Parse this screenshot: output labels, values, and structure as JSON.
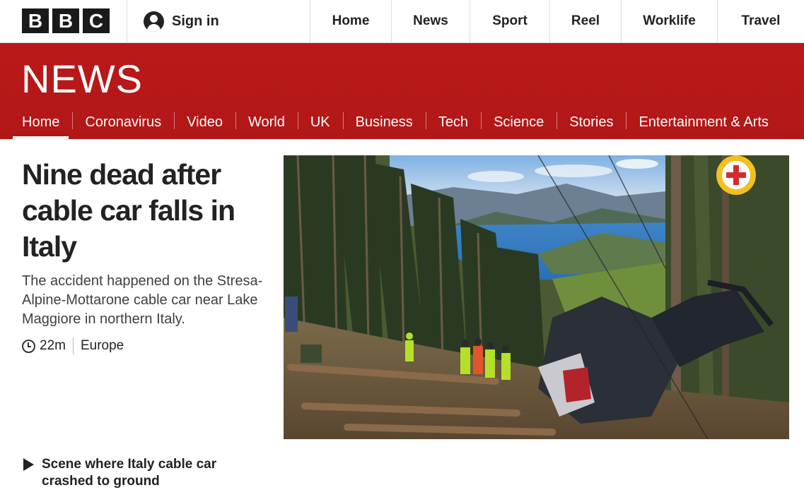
{
  "brand": {
    "letters": [
      "B",
      "B",
      "C"
    ]
  },
  "header": {
    "signin_label": "Sign in",
    "nav": [
      "Home",
      "News",
      "Sport",
      "Reel",
      "Worklife",
      "Travel"
    ]
  },
  "section": {
    "title": "NEWS",
    "nav": [
      "Home",
      "Coronavirus",
      "Video",
      "World",
      "UK",
      "Business",
      "Tech",
      "Science",
      "Stories",
      "Entertainment & Arts"
    ],
    "active": "Home"
  },
  "article": {
    "headline": "Nine dead after cable car falls in Italy",
    "summary": "The accident happened on the Stresa-Alpine-Mottarone cable car near Lake Maggiore in northern Italy.",
    "time": "22m",
    "tag": "Europe"
  },
  "related": {
    "title": "Scene where Italy cable car crashed to ground"
  },
  "colors": {
    "brand_red": "#bb1919",
    "text": "#222222"
  }
}
